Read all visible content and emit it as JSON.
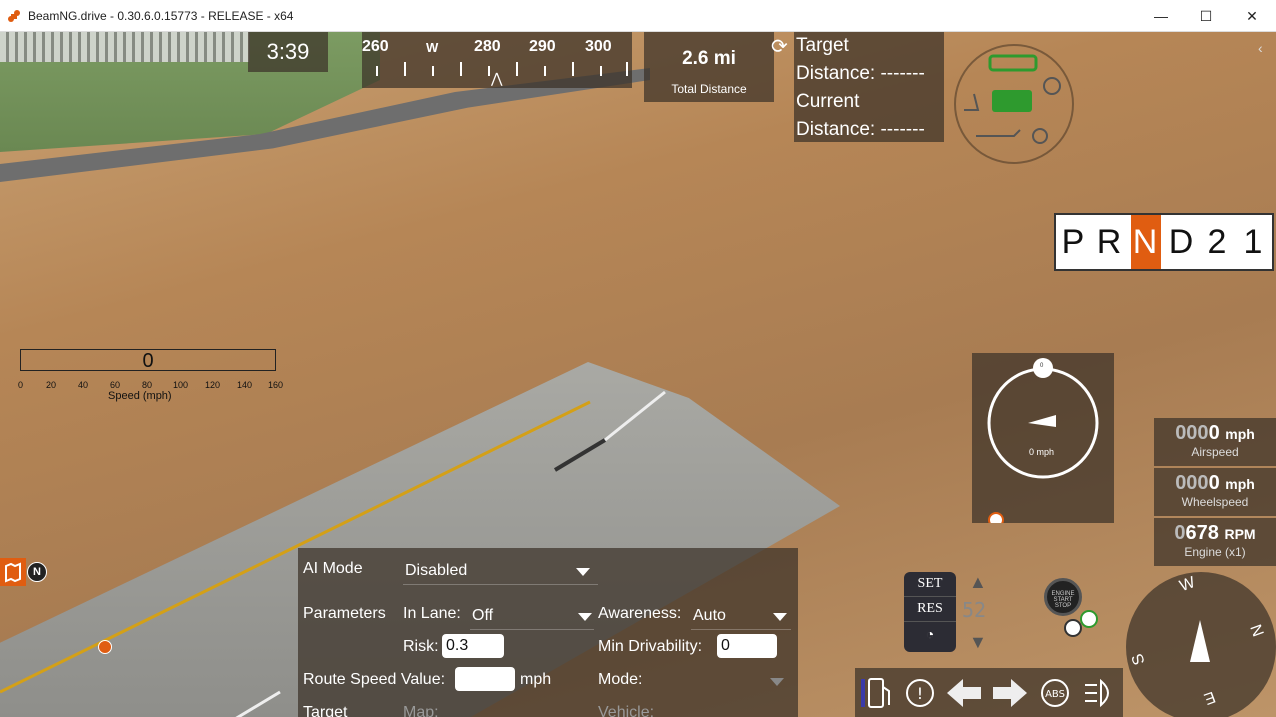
{
  "window": {
    "title": "BeamNG.drive - 0.30.6.0.15773 - RELEASE - x64",
    "minimize": "—",
    "maximize": "☐",
    "close": "✕"
  },
  "hud": {
    "clock": "3:39",
    "heading": {
      "labels": [
        "260",
        "W",
        "280",
        "290",
        "300"
      ],
      "pointer": "⋀"
    },
    "total_distance": {
      "value": "2.6 mi",
      "caption": "Total Distance"
    },
    "target": {
      "target_label": "Target",
      "target_distance": "Distance: -------",
      "current_label": "Current",
      "current_distance": "Distance: -------"
    },
    "gears": [
      "P",
      "R",
      "N",
      "D",
      "2",
      "1"
    ],
    "active_gear": "N",
    "speed_bar": {
      "value": "0",
      "ticks": [
        "0",
        "20",
        "40",
        "60",
        "80",
        "100",
        "120",
        "140",
        "160"
      ],
      "caption": "Speed (mph)"
    },
    "tacho": {
      "top": "0",
      "speed": "0 mph"
    },
    "readouts": [
      {
        "dim": "000",
        "bold": "0",
        "unit": "mph",
        "caption": "Airspeed"
      },
      {
        "dim": "000",
        "bold": "0",
        "unit": "mph",
        "caption": "Wheelspeed"
      },
      {
        "dim": "0",
        "bold": "678",
        "unit": "RPM",
        "caption": "Engine (x1)"
      }
    ],
    "cruise": {
      "set": "SET",
      "res": "RES",
      "display": "52"
    },
    "start_stop": "ENGINE START STOP",
    "nav": {
      "w": "W",
      "n": "N",
      "s": "S",
      "e": "E"
    },
    "north_badge": "N",
    "ai": {
      "mode_label": "AI Mode",
      "mode_value": "Disabled",
      "params_label": "Parameters",
      "in_lane_label": "In Lane:",
      "in_lane_value": "Off",
      "awareness_label": "Awareness:",
      "awareness_value": "Auto",
      "risk_label": "Risk:",
      "risk_value": "0.3",
      "min_driv_label": "Min Drivability:",
      "min_driv_value": "0",
      "route_speed_label": "Route Speed Value:",
      "route_speed_unit": "mph",
      "route_mode_label": "Mode:",
      "target_label": "Target",
      "map_label": "Map:",
      "vehicle_label": "Vehicle:"
    }
  },
  "colors": {
    "accent": "#e05d11",
    "engine_ok": "#2e9a2e"
  }
}
